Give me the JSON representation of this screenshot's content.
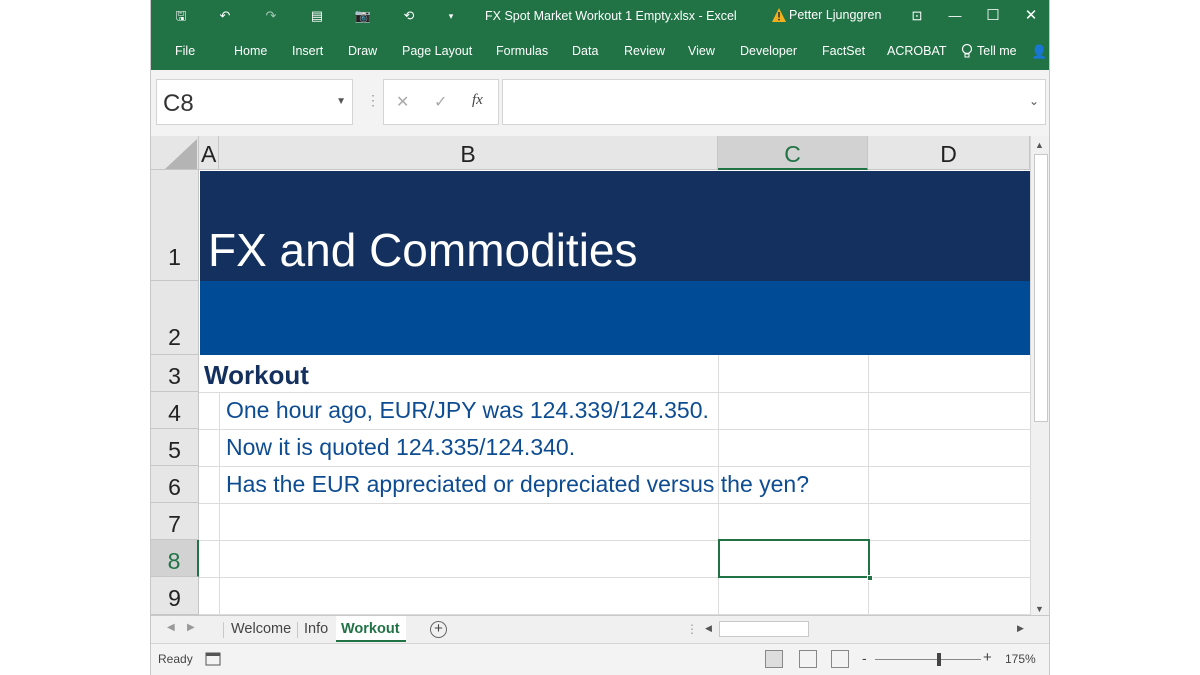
{
  "window": {
    "title": "FX Spot Market Workout 1 Empty.xlsx  -  Excel",
    "user": "Petter Ljunggren",
    "minimize": "—",
    "maximize": "☐",
    "close": "✕",
    "ribbon_options": "⊡",
    "qat": {
      "save": "🖫",
      "undo": "↶",
      "redo": "↷",
      "icon3": "▤",
      "camera": "📷",
      "icon5": "⟲",
      "customize": "▾"
    }
  },
  "ribbon": {
    "tabs": [
      "File",
      "Home",
      "Insert",
      "Draw",
      "Page Layout",
      "Formulas",
      "Data",
      "Review",
      "View",
      "Developer",
      "FactSet",
      "ACROBAT",
      "Tell me"
    ],
    "share_icon": "👤"
  },
  "formula_bar": {
    "name_box": "C8",
    "cancel": "✕",
    "enter": "✓",
    "fx": "fx",
    "value": ""
  },
  "columns": [
    "A",
    "B",
    "C",
    "D"
  ],
  "selected_column": "C",
  "rows": [
    "1",
    "2",
    "3",
    "4",
    "5",
    "6",
    "7",
    "8",
    "9"
  ],
  "selected_row": "8",
  "cells": {
    "B1": "FX and Commodities",
    "A3": "Workout",
    "B4": "One hour ago, EUR/JPY was 124.339/124.350.",
    "B5": "Now it is quoted 124.335/124.340.",
    "B6": "Has the EUR appreciated or depreciated versus the yen?"
  },
  "sheets": {
    "tabs": [
      "Welcome",
      "Info",
      "Workout"
    ],
    "active": "Workout",
    "add": "+"
  },
  "status": {
    "text": "Ready",
    "zoom": "175%",
    "zoom_minus": "-",
    "zoom_plus": "+"
  },
  "colors": {
    "excel_green": "#217346",
    "title_band": "#14305f",
    "sub_band": "#004b96",
    "text_blue": "#0e4c92"
  }
}
